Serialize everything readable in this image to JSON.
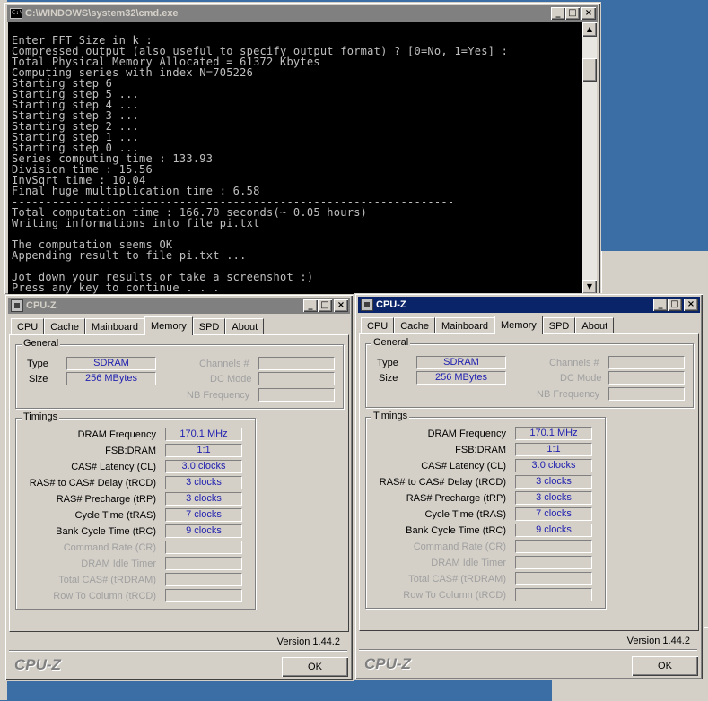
{
  "cmd": {
    "title": "C:\\WINDOWS\\system32\\cmd.exe",
    "lines": [
      "Enter FFT Size in k :",
      "Compressed output (also useful to specify output format) ? [0=No, 1=Yes] :",
      "Total Physical Memory Allocated = 61372 Kbytes",
      "Computing series with index N=705226",
      "Starting step 6",
      "Starting step 5 ...",
      "Starting step 4 ...",
      "Starting step 3 ...",
      "Starting step 2 ...",
      "Starting step 1 ...",
      "Starting step 0 ...",
      "Series computing time : 133.93",
      "Division time : 15.56",
      "InvSqrt time : 10.04",
      "Final huge multiplication time : 6.58",
      "------------------------------------------------------------------",
      "Total computation time : 166.70 seconds(~ 0.05 hours)",
      "Writing informations into file pi.txt",
      "",
      "The computation seems OK",
      "Appending result to file pi.txt ...",
      "",
      "Jot down your results or take a screenshot :)",
      "Press any key to continue . . ."
    ]
  },
  "cpuz_left": {
    "title": "CPU-Z",
    "tabs": [
      "CPU",
      "Cache",
      "Mainboard",
      "Memory",
      "SPD",
      "About"
    ],
    "general_label": "General",
    "type_label": "Type",
    "type_value": "SDRAM",
    "size_label": "Size",
    "size_value": "256 MBytes",
    "channels_label": "Channels #",
    "dcmode_label": "DC Mode",
    "nbfreq_label": "NB Frequency",
    "timings_label": "Timings",
    "timings": [
      {
        "label": "DRAM Frequency",
        "value": "170.1 MHz"
      },
      {
        "label": "FSB:DRAM",
        "value": "1:1"
      },
      {
        "label": "CAS# Latency (CL)",
        "value": "3.0 clocks"
      },
      {
        "label": "RAS# to CAS# Delay (tRCD)",
        "value": "3 clocks"
      },
      {
        "label": "RAS# Precharge (tRP)",
        "value": "3 clocks"
      },
      {
        "label": "Cycle Time (tRAS)",
        "value": "7 clocks"
      },
      {
        "label": "Bank Cycle Time (tRC)",
        "value": "9 clocks"
      },
      {
        "label": "Command Rate (CR)",
        "value": ""
      },
      {
        "label": "DRAM Idle Timer",
        "value": ""
      },
      {
        "label": "Total CAS# (tRDRAM)",
        "value": ""
      },
      {
        "label": "Row To Column (tRCD)",
        "value": ""
      }
    ],
    "version": "Version 1.44.2",
    "brand": "CPU-Z",
    "ok": "OK"
  },
  "cpuz_right": {
    "title": "CPU-Z",
    "tabs": [
      "CPU",
      "Cache",
      "Mainboard",
      "Memory",
      "SPD",
      "About"
    ],
    "general_label": "General",
    "type_label": "Type",
    "type_value": "SDRAM",
    "size_label": "Size",
    "size_value": "256 MBytes",
    "channels_label": "Channels #",
    "dcmode_label": "DC Mode",
    "nbfreq_label": "NB Frequency",
    "timings_label": "Timings",
    "timings": [
      {
        "label": "DRAM Frequency",
        "value": "170.1 MHz"
      },
      {
        "label": "FSB:DRAM",
        "value": "1:1"
      },
      {
        "label": "CAS# Latency (CL)",
        "value": "3.0 clocks"
      },
      {
        "label": "RAS# to CAS# Delay (tRCD)",
        "value": "3 clocks"
      },
      {
        "label": "RAS# Precharge (tRP)",
        "value": "3 clocks"
      },
      {
        "label": "Cycle Time (tRAS)",
        "value": "7 clocks"
      },
      {
        "label": "Bank Cycle Time (tRC)",
        "value": "9 clocks"
      },
      {
        "label": "Command Rate (CR)",
        "value": ""
      },
      {
        "label": "DRAM Idle Timer",
        "value": ""
      },
      {
        "label": "Total CAS# (tRDRAM)",
        "value": ""
      },
      {
        "label": "Row To Column (tRCD)",
        "value": ""
      }
    ],
    "version": "Version 1.44.2",
    "brand": "CPU-Z",
    "ok": "OK"
  },
  "colors": {
    "desktop": "#3a6ea5",
    "title_active": "#0a246a",
    "title_inactive": "#808080",
    "value_text": "#2020b0"
  },
  "icons": {
    "minimize": "minimize-icon",
    "maximize": "maximize-icon",
    "close": "close-icon"
  }
}
